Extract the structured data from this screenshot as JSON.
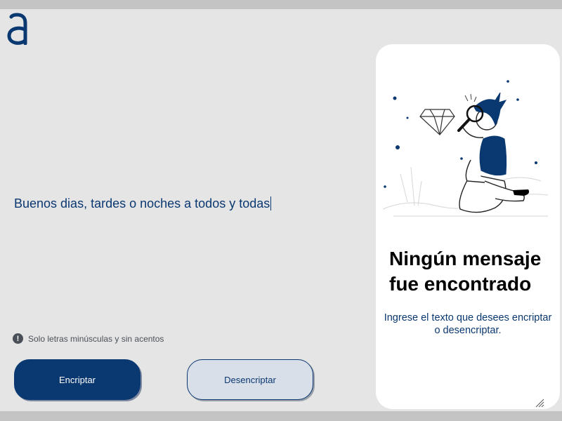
{
  "app": {
    "logo_icon": "alura-logo-icon",
    "accent_color": "#0a3871"
  },
  "input": {
    "value": "Buenos dias, tardes o noches a todos y todas"
  },
  "hint": {
    "icon": "exclamation-icon",
    "text": "Solo letras minúsculas y sin acentos"
  },
  "buttons": {
    "encrypt_label": "Encriptar",
    "decrypt_label": "Desencriptar"
  },
  "output_panel": {
    "illustration": "person-with-magnifier-illustration",
    "title": "Ningún mensaje fue encontrado",
    "subtitle": "Ingrese el texto que desees encriptar o desencriptar."
  }
}
